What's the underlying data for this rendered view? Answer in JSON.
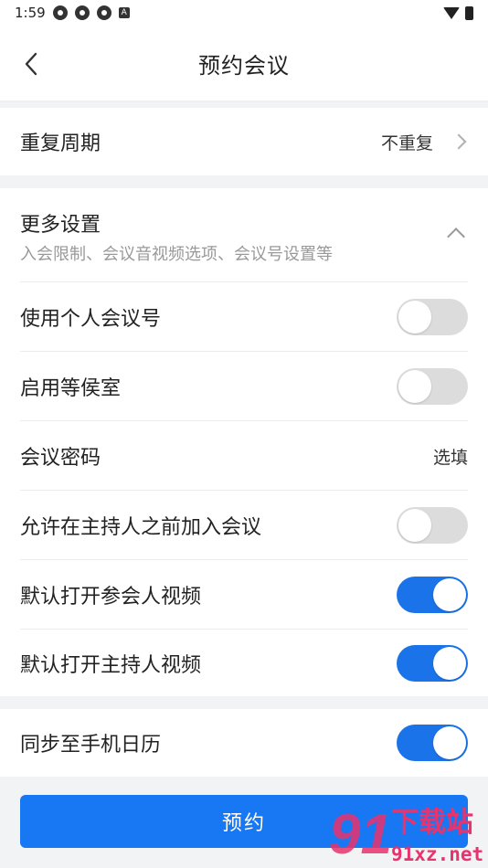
{
  "status_bar": {
    "time": "1:59",
    "a_label": "A"
  },
  "header": {
    "title": "预约会议",
    "back_icon": "chevron-left-icon"
  },
  "repeat": {
    "label": "重复周期",
    "value": "不重复"
  },
  "more_settings": {
    "title": "更多设置",
    "subtitle": "入会限制、会议音视频选项、会议号设置等"
  },
  "settings": [
    {
      "label": "使用个人会议号",
      "on": false
    },
    {
      "label": "启用等侯室",
      "on": false
    },
    {
      "label": "会议密码",
      "value": "选填"
    },
    {
      "label": "允许在主持人之前加入会议",
      "on": false
    },
    {
      "label": "默认打开参会人视频",
      "on": true
    },
    {
      "label": "默认打开主持人视频",
      "on": true
    }
  ],
  "calendar": {
    "label": "同步至手机日历",
    "on": true
  },
  "primary_button": {
    "label": "预约"
  },
  "watermark": {
    "brand": "下载站",
    "site": "91xz.net",
    "logo": "91"
  },
  "colors": {
    "accent": "#1877f2",
    "toggle_off": "#dcdcdc",
    "background": "#f2f3f5"
  }
}
